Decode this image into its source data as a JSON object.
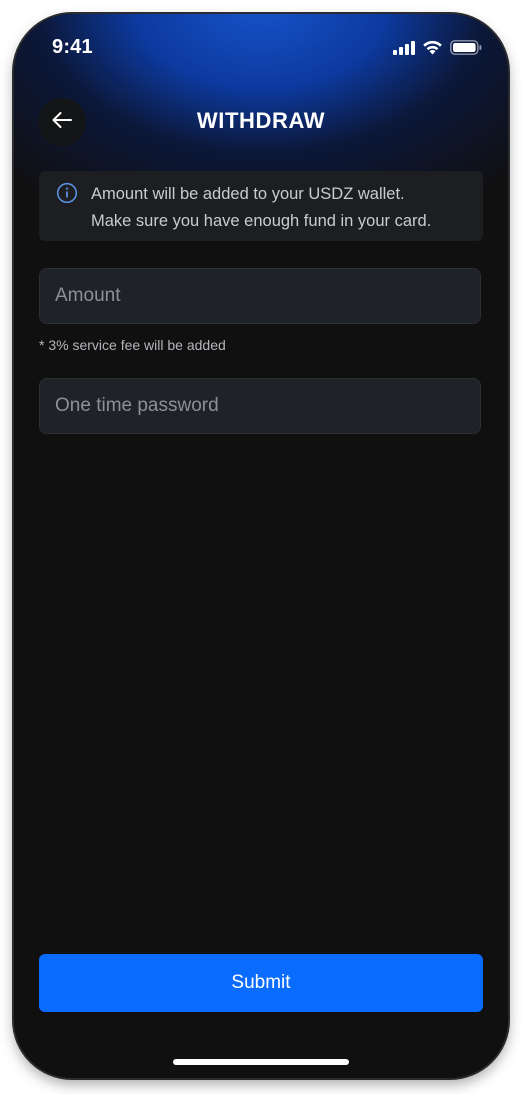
{
  "status_bar": {
    "time": "9:41",
    "icons": [
      "cellular-signal-icon",
      "wifi-icon",
      "battery-icon"
    ]
  },
  "header": {
    "back_icon": "arrow-left-icon",
    "title": "WITHDRAW"
  },
  "info_banner": {
    "icon": "info-circle-icon",
    "line1": "Amount will be added to your USDZ wallet.",
    "line2": "Make sure you have enough fund in your card."
  },
  "form": {
    "amount": {
      "placeholder": "Amount",
      "value": ""
    },
    "fee_note": "* 3% service fee will be added",
    "otp": {
      "placeholder": "One time password",
      "value": ""
    }
  },
  "actions": {
    "submit_label": "Submit"
  },
  "colors": {
    "background": "#101011",
    "glow": "#1753c9",
    "accent": "#0a6cff",
    "field": "#1f2226",
    "banner": "#1c1e22",
    "info_icon": "#5b8fe0"
  }
}
